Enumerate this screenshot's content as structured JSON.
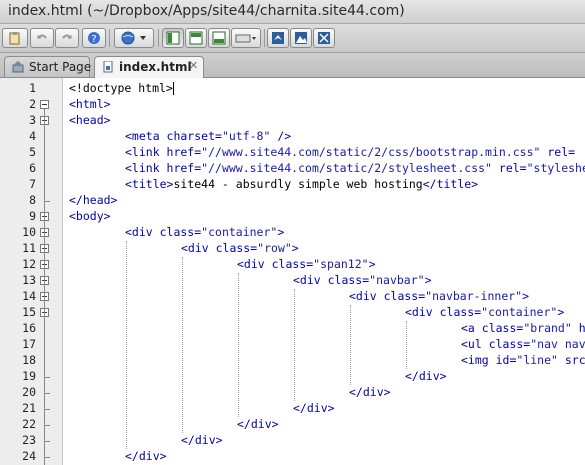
{
  "window": {
    "title": "index.html (~/Dropbox/Apps/site44/charnita.site44.com)"
  },
  "toolbar": {
    "buttons": [
      {
        "name": "paste-icon"
      },
      {
        "name": "undo-icon"
      },
      {
        "name": "redo-icon"
      },
      {
        "name": "help-icon"
      },
      {
        "name": "browser-preview-icon"
      },
      {
        "name": "split-left-icon"
      },
      {
        "name": "split-top-icon"
      },
      {
        "name": "split-bottom-icon"
      },
      {
        "name": "keyboard-icon"
      },
      {
        "name": "bird-icon"
      },
      {
        "name": "mountain-icon"
      },
      {
        "name": "expand-icon"
      }
    ]
  },
  "tabs": [
    {
      "label": "Start Page",
      "active": false
    },
    {
      "label": "index.html",
      "active": true,
      "close": "✕"
    }
  ],
  "editor": {
    "lines": [
      {
        "n": "1",
        "parts": [
          [
            "txt",
            "<!doctype html>"
          ]
        ],
        "cursor": true
      },
      {
        "n": "2",
        "parts": [
          [
            "tag",
            "<html>"
          ]
        ]
      },
      {
        "n": "3",
        "parts": [
          [
            "tag",
            "<head>"
          ]
        ]
      },
      {
        "n": "4",
        "indent": 8,
        "parts": [
          [
            "tag",
            "<meta charset="
          ],
          [
            "str",
            "\"utf-8\""
          ],
          [
            "tag",
            " />"
          ]
        ]
      },
      {
        "n": "5",
        "indent": 8,
        "parts": [
          [
            "tag",
            "<link href="
          ],
          [
            "str",
            "\"//www.site44.com/static/2/css/bootstrap.min.css\""
          ],
          [
            "tag",
            " rel="
          ]
        ]
      },
      {
        "n": "6",
        "indent": 8,
        "parts": [
          [
            "tag",
            "<link href="
          ],
          [
            "str",
            "\"//www.site44.com/static/2/stylesheet.css\""
          ],
          [
            "tag",
            " rel="
          ],
          [
            "str",
            "\"styleshe"
          ]
        ]
      },
      {
        "n": "7",
        "indent": 8,
        "parts": [
          [
            "tag",
            "<title>"
          ],
          [
            "txt",
            "site44 - absurdly simple web hosting"
          ],
          [
            "tag",
            "</title>"
          ]
        ]
      },
      {
        "n": "8",
        "parts": [
          [
            "tag",
            "</head>"
          ]
        ]
      },
      {
        "n": "9",
        "parts": [
          [
            "tag",
            "<body>"
          ]
        ]
      },
      {
        "n": "10",
        "indent": 8,
        "parts": [
          [
            "tag",
            "<div class="
          ],
          [
            "str",
            "\"container\""
          ],
          [
            "tag",
            ">"
          ]
        ]
      },
      {
        "n": "11",
        "indent": 16,
        "parts": [
          [
            "tag",
            "<div class="
          ],
          [
            "str",
            "\"row\""
          ],
          [
            "tag",
            ">"
          ]
        ]
      },
      {
        "n": "12",
        "indent": 24,
        "parts": [
          [
            "tag",
            "<div class="
          ],
          [
            "str",
            "\"span12\""
          ],
          [
            "tag",
            ">"
          ]
        ]
      },
      {
        "n": "13",
        "indent": 32,
        "parts": [
          [
            "tag",
            "<div class="
          ],
          [
            "str",
            "\"navbar\""
          ],
          [
            "tag",
            ">"
          ]
        ]
      },
      {
        "n": "14",
        "indent": 40,
        "parts": [
          [
            "tag",
            "<div class="
          ],
          [
            "str",
            "\"navbar-inner\""
          ],
          [
            "tag",
            ">"
          ]
        ]
      },
      {
        "n": "15",
        "indent": 48,
        "parts": [
          [
            "tag",
            "<div class="
          ],
          [
            "str",
            "\"container\""
          ],
          [
            "tag",
            ">"
          ]
        ]
      },
      {
        "n": "16",
        "indent": 56,
        "parts": [
          [
            "tag",
            "<a class="
          ],
          [
            "str",
            "\"brand\""
          ],
          [
            "tag",
            " h"
          ]
        ]
      },
      {
        "n": "17",
        "indent": 56,
        "parts": [
          [
            "tag",
            "<ul class="
          ],
          [
            "str",
            "\"nav nav"
          ]
        ]
      },
      {
        "n": "18",
        "indent": 56,
        "parts": [
          [
            "tag",
            "<img id="
          ],
          [
            "str",
            "\"line\""
          ],
          [
            "tag",
            " src"
          ]
        ]
      },
      {
        "n": "19",
        "indent": 48,
        "parts": [
          [
            "tag",
            "</div>"
          ]
        ]
      },
      {
        "n": "20",
        "indent": 40,
        "parts": [
          [
            "tag",
            "</div>"
          ]
        ]
      },
      {
        "n": "21",
        "indent": 32,
        "parts": [
          [
            "tag",
            "</div>"
          ]
        ]
      },
      {
        "n": "22",
        "indent": 24,
        "parts": [
          [
            "tag",
            "</div>"
          ]
        ]
      },
      {
        "n": "23",
        "indent": 16,
        "parts": [
          [
            "tag",
            "</div>"
          ]
        ]
      },
      {
        "n": "24",
        "indent": 8,
        "parts": [
          [
            "tag",
            "</div>"
          ]
        ]
      }
    ]
  }
}
